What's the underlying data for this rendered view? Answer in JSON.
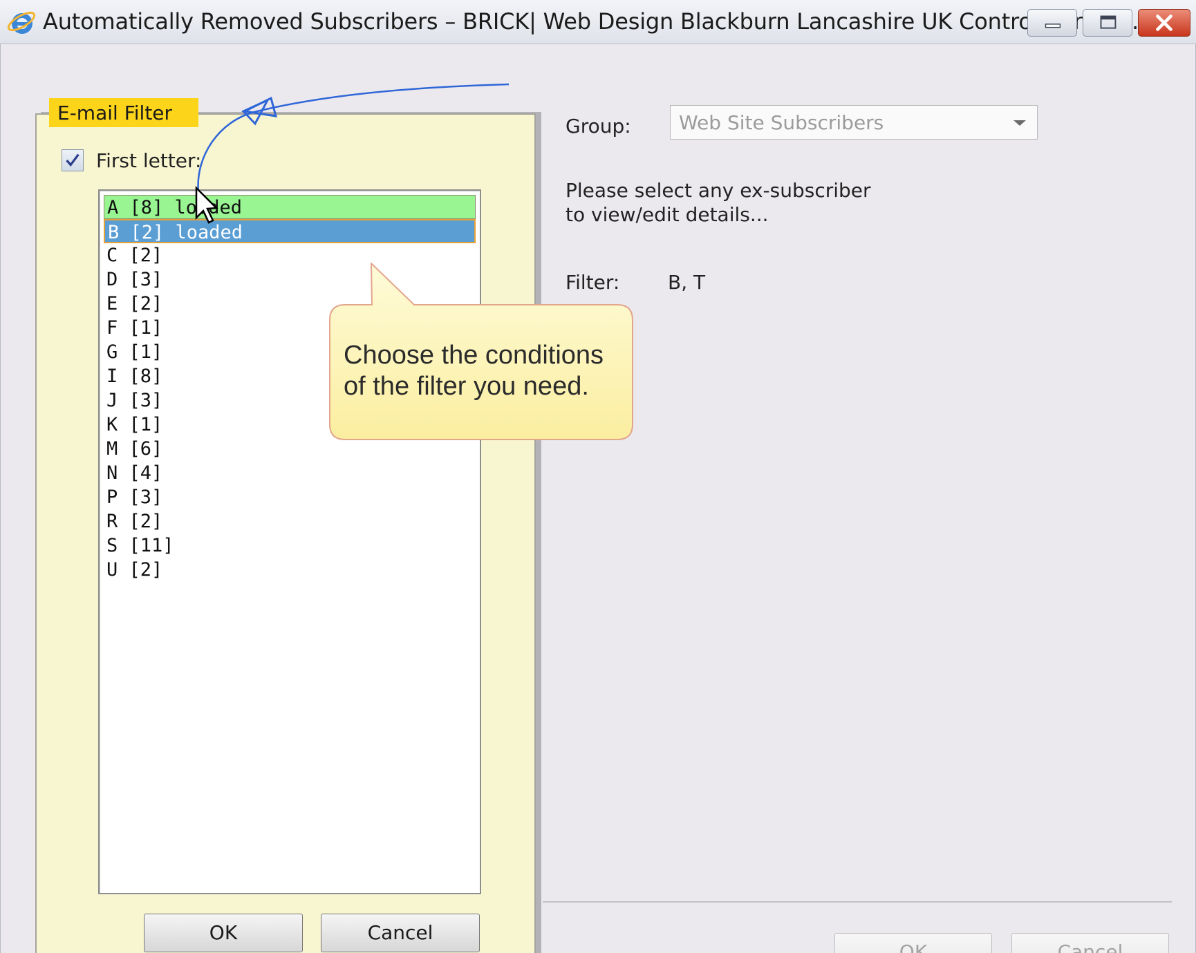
{
  "window": {
    "title": "Automatically Removed Subscribers – BRICK| Web Design Blackburn Lancashire UK Control Centre ...",
    "icon": "internet-explorer-icon"
  },
  "filter_panel": {
    "tab_label": "E-mail Filter",
    "checkbox_label": "First letter:",
    "checkbox_checked": true,
    "letters": [
      {
        "text": "A [8] loaded",
        "state": "loaded"
      },
      {
        "text": "B [2] loaded",
        "state": "selected"
      },
      {
        "text": "C [2]",
        "state": "normal"
      },
      {
        "text": "D [3]",
        "state": "normal"
      },
      {
        "text": "E [2]",
        "state": "normal"
      },
      {
        "text": "F [1]",
        "state": "normal"
      },
      {
        "text": "G [1]",
        "state": "normal"
      },
      {
        "text": "I [8]",
        "state": "normal"
      },
      {
        "text": "J [3]",
        "state": "normal"
      },
      {
        "text": "K [1]",
        "state": "normal"
      },
      {
        "text": "M [6]",
        "state": "normal"
      },
      {
        "text": "N [4]",
        "state": "normal"
      },
      {
        "text": "P [3]",
        "state": "normal"
      },
      {
        "text": "R [2]",
        "state": "normal"
      },
      {
        "text": "S [11]",
        "state": "normal"
      },
      {
        "text": "U [2]",
        "state": "normal"
      }
    ],
    "ok_label": "OK",
    "cancel_label": "Cancel"
  },
  "right_panel": {
    "group_label": "Group:",
    "group_value": "Web Site Subscribers",
    "message_line1": "Please select any ex-subscriber",
    "message_line2": "to view/edit details...",
    "filter_label": "Filter:",
    "filter_value": "B, T",
    "ok_label": "OK",
    "cancel_label": "Cancel"
  },
  "callout": {
    "text": "Choose the conditions of the filter you need."
  },
  "colors": {
    "panel_bg": "#f8f6d0",
    "tab_bg": "#fcd51a",
    "loaded_row": "#98f592",
    "selected_row": "#5b9ed4",
    "callout_bg": "#fdf3a8",
    "annotation_arrow": "#2f66d8"
  }
}
